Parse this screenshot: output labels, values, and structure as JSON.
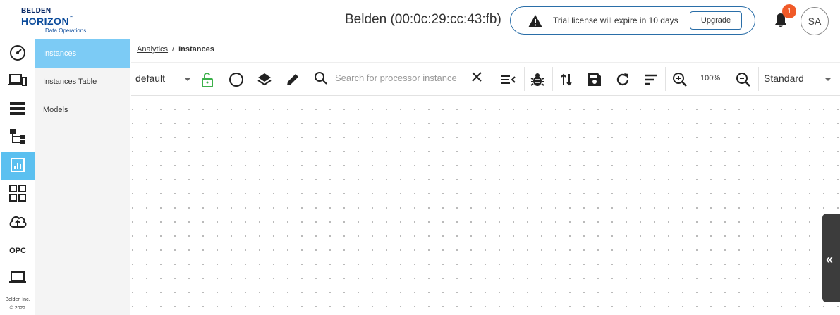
{
  "header": {
    "logo": {
      "line1": "BELDEN",
      "line2": "HORIZON",
      "tm": "™",
      "line3": "Data Operations"
    },
    "device_title": "Belden (00:0c:29:cc:43:fb)",
    "license": {
      "message": "Trial license will expire in 10 days",
      "upgrade_label": "Upgrade"
    },
    "notifications_count": "1",
    "avatar_initials": "SA"
  },
  "rail": {
    "items": [
      {
        "icon": "speedometer-icon"
      },
      {
        "icon": "devices-icon"
      },
      {
        "icon": "list-icon"
      },
      {
        "icon": "hierarchy-icon"
      },
      {
        "icon": "analytics-icon",
        "active": true
      },
      {
        "icon": "apps-grid-icon"
      },
      {
        "icon": "cloud-upload-icon"
      },
      {
        "label": "OPC"
      },
      {
        "icon": "laptop-icon"
      }
    ],
    "footer_line1": "Belden Inc.",
    "footer_line2": "© 2022"
  },
  "submenu": {
    "items": [
      {
        "label": "Instances",
        "active": true
      },
      {
        "label": "Instances Table"
      },
      {
        "label": "Models"
      }
    ]
  },
  "breadcrumb": {
    "parent": "Analytics",
    "separator": "/",
    "current": "Instances"
  },
  "toolbar": {
    "selected_model": "default",
    "search_placeholder": "Search for processor instance",
    "search_value": "",
    "zoom": "100%",
    "view_mode": "Standard"
  },
  "colors": {
    "accent": "#5bc0f0",
    "submenu_active": "#7ccbf5",
    "badge": "#f05a28",
    "lock_green": "#3cb04a"
  }
}
